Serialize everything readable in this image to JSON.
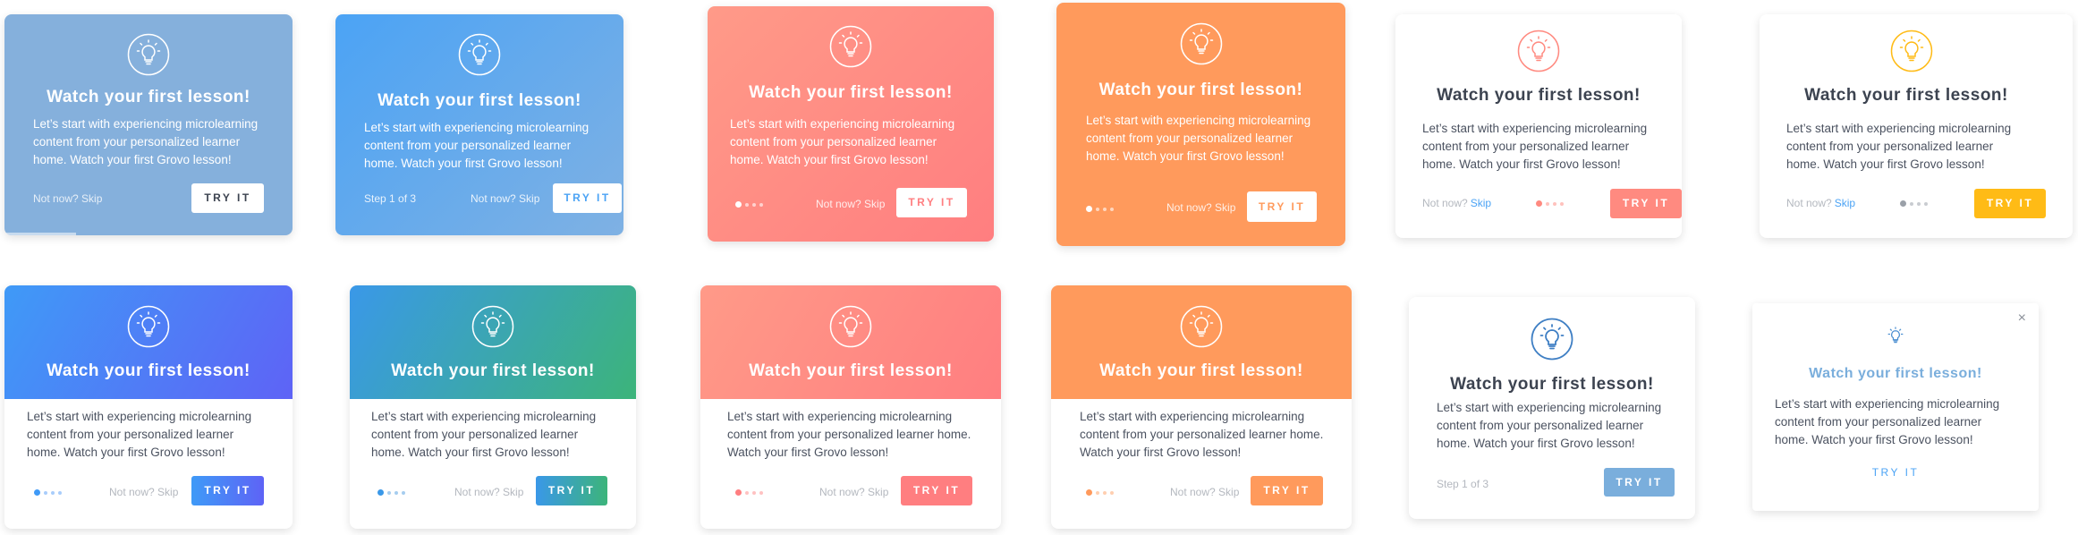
{
  "colors": {
    "blue_muted": "#85b0dc",
    "blue_bright": "#4ba3f5",
    "coral": "#ff8a80",
    "orange": "#ff9a5c",
    "yellow": "#ffbb16",
    "indigo": "#5e63f6",
    "green": "#3cb47a",
    "light_blue": "#7aaedc",
    "text_dark": "#3c4350",
    "text_body": "#4b5260"
  },
  "icons": {
    "lightbulb": "lightbulb-icon",
    "close": "close-icon"
  },
  "cards": [
    {
      "title": "Watch your first lesson!",
      "body": "Let’s start with experiencing microlearning content from your personalized learner home. Watch your first Grovo lesson!",
      "skip": "Not now? Skip",
      "cta": "TRY IT"
    },
    {
      "title": "Watch your first lesson!",
      "body": "Let’s start with experiencing microlearning content from your personalized learner home. Watch your first Grovo lesson!",
      "step": "Step 1 of 3",
      "skip": "Not now? Skip",
      "cta": "TRY IT"
    },
    {
      "title": "Watch your first lesson!",
      "body": "Let’s start with experiencing microlearning content from your personalized learner home. Watch your first Grovo lesson!",
      "skip": "Not now? Skip",
      "cta": "TRY IT"
    },
    {
      "title": "Watch your first lesson!",
      "body": "Let’s start with experiencing microlearning content from your personalized learner home. Watch your first Grovo lesson!",
      "skip": "Not now? Skip",
      "cta": "TRY IT"
    },
    {
      "title": "Watch your first lesson!",
      "body": "Let’s start with experiencing microlearning content from your personalized learner home. Watch your first Grovo lesson!",
      "skip_prefix": "Not now?",
      "skip_link": "Skip",
      "cta": "TRY IT"
    },
    {
      "title": "Watch your first lesson!",
      "body": "Let’s start with experiencing microlearning content from your personalized learner home. Watch your first Grovo lesson!",
      "skip_prefix": "Not now?",
      "skip_link": "Skip",
      "cta": "TRY IT"
    },
    {
      "title": "Watch your first lesson!",
      "body": "Let’s start with experiencing microlearning content from your personalized learner home. Watch your first Grovo lesson!",
      "skip": "Not now? Skip",
      "cta": "TRY IT"
    },
    {
      "title": "Watch your first lesson!",
      "body": "Let’s start with experiencing microlearning content from your personalized learner home. Watch your first Grovo lesson!",
      "skip": "Not now? Skip",
      "cta": "TRY IT"
    },
    {
      "title": "Watch your first lesson!",
      "body": "Let’s start with experiencing microlearning content from your personalized learner home. Watch your first Grovo lesson!",
      "skip": "Not now? Skip",
      "cta": "TRY IT"
    },
    {
      "title": "Watch your first lesson!",
      "body": "Let’s start with experiencing microlearning content from your personalized learner home. Watch your first Grovo lesson!",
      "skip": "Not now? Skip",
      "cta": "TRY IT"
    },
    {
      "title": "Watch your first lesson!",
      "body": "Let’s start with experiencing microlearning content from your personalized learner home. Watch your first Grovo lesson!",
      "step": "Step 1 of 3",
      "cta": "TRY IT"
    },
    {
      "title": "Watch your first lesson!",
      "body": "Let’s start with experiencing microlearning content from your personalized learner home. Watch your first Grovo lesson!",
      "cta": "TRY IT",
      "close": "×"
    }
  ]
}
